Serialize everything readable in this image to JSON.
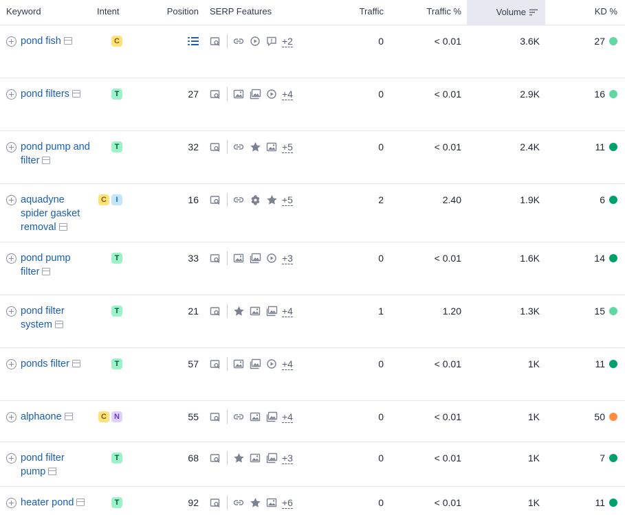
{
  "header": {
    "keyword": "Keyword",
    "intent": "Intent",
    "position": "Position",
    "serp": "SERP Features",
    "traffic": "Traffic",
    "traffic_pct": "Traffic %",
    "volume": "Volume",
    "kd": "KD %"
  },
  "colors": {
    "link": "#1a5db7",
    "kd_light_green": "#5fd9a0",
    "kd_dark_green": "#009f6b",
    "kd_orange": "#ff8c42",
    "volume_header_bg": "#e8e9f0"
  },
  "rows": [
    {
      "keyword": "pond fish",
      "intents": [
        "C"
      ],
      "position": "",
      "position_icon": "featured-list-icon",
      "serp": [
        "image-pack-icon",
        "|",
        "link-icon",
        "video-icon",
        "faq-icon"
      ],
      "more": "+2",
      "traffic": "0",
      "traffic_pct": "< 0.01",
      "volume": "3.6K",
      "kd": "27",
      "kd_color": "#5fd9a0"
    },
    {
      "keyword": "pond filters",
      "intents": [
        "T"
      ],
      "position": "27",
      "serp": [
        "image-pack-icon",
        "|",
        "image-icon",
        "images-icon",
        "video-icon"
      ],
      "more": "+4",
      "traffic": "0",
      "traffic_pct": "< 0.01",
      "volume": "2.9K",
      "kd": "16",
      "kd_color": "#5fd9a0"
    },
    {
      "keyword": "pond pump and filter",
      "intents": [
        "T"
      ],
      "position": "32",
      "serp": [
        "image-pack-icon",
        "|",
        "link-icon",
        "star-icon",
        "image-icon"
      ],
      "more": "+5",
      "traffic": "0",
      "traffic_pct": "< 0.01",
      "volume": "2.4K",
      "kd": "11",
      "kd_color": "#009f6b"
    },
    {
      "keyword": "aquadyne spider gasket removal",
      "intents": [
        "C",
        "I"
      ],
      "position": "16",
      "serp": [
        "image-pack-icon",
        "|",
        "link-icon",
        "knowledge-icon",
        "star-icon"
      ],
      "more": "+5",
      "traffic": "2",
      "traffic_pct": "2.40",
      "volume": "1.9K",
      "kd": "6",
      "kd_color": "#009f6b"
    },
    {
      "keyword": "pond pump filter",
      "intents": [
        "T"
      ],
      "position": "33",
      "serp": [
        "image-pack-icon",
        "|",
        "image-icon",
        "images-icon",
        "video-icon"
      ],
      "more": "+3",
      "traffic": "0",
      "traffic_pct": "< 0.01",
      "volume": "1.6K",
      "kd": "14",
      "kd_color": "#009f6b"
    },
    {
      "keyword": "pond filter system",
      "intents": [
        "T"
      ],
      "position": "21",
      "serp": [
        "image-pack-icon",
        "|",
        "star-icon",
        "image-icon",
        "images-icon"
      ],
      "more": "+4",
      "traffic": "1",
      "traffic_pct": "1.20",
      "volume": "1.3K",
      "kd": "15",
      "kd_color": "#5fd9a0"
    },
    {
      "keyword": "ponds filter",
      "intents": [
        "T"
      ],
      "position": "57",
      "serp": [
        "image-pack-icon",
        "|",
        "image-icon",
        "images-icon",
        "video-icon"
      ],
      "more": "+4",
      "traffic": "0",
      "traffic_pct": "< 0.01",
      "volume": "1K",
      "kd": "11",
      "kd_color": "#009f6b"
    },
    {
      "keyword": "alphaone",
      "intents": [
        "C",
        "N"
      ],
      "position": "55",
      "serp": [
        "image-pack-icon",
        "|",
        "link-icon",
        "image-icon",
        "images-icon"
      ],
      "more": "+4",
      "traffic": "0",
      "traffic_pct": "< 0.01",
      "volume": "1K",
      "kd": "50",
      "kd_color": "#ff8c42"
    },
    {
      "keyword": "pond filter pump",
      "intents": [
        "T"
      ],
      "position": "68",
      "serp": [
        "image-pack-icon",
        "|",
        "star-icon",
        "image-icon",
        "images-icon"
      ],
      "more": "+3",
      "traffic": "0",
      "traffic_pct": "< 0.01",
      "volume": "1K",
      "kd": "7",
      "kd_color": "#009f6b"
    },
    {
      "keyword": "heater pond",
      "intents": [
        "T"
      ],
      "position": "92",
      "serp": [
        "image-pack-icon",
        "|",
        "link-icon",
        "star-icon",
        "image-icon"
      ],
      "more": "+6",
      "traffic": "0",
      "traffic_pct": "< 0.01",
      "volume": "1K",
      "kd": "11",
      "kd_color": "#009f6b"
    }
  ]
}
